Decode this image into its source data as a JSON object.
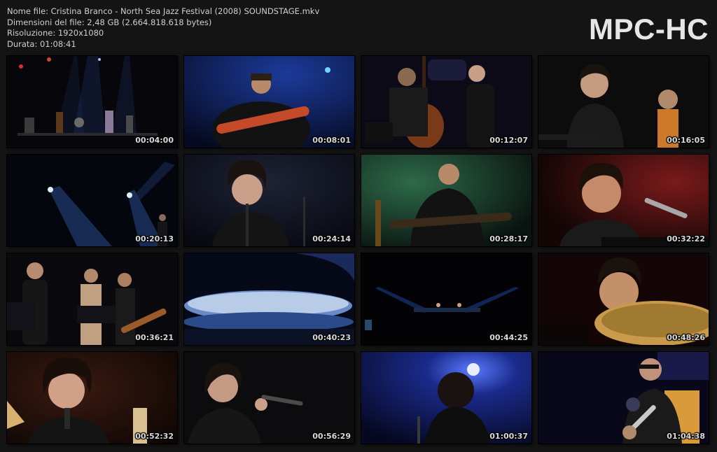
{
  "info": {
    "file_name": "Nome file: Cristina Branco - North Sea Jazz Festival (2008) SOUNDSTAGE.mkv",
    "file_size": "Dimensioni del file: 2,48 GB (2.664.818.618 bytes)",
    "resolution": "Risoluzione: 1920x1080",
    "duration": "Durata: 01:08:41"
  },
  "logo": "MPC-HC",
  "thumbnails": [
    {
      "time": "00:04:00",
      "scene": "wide-stage-band"
    },
    {
      "time": "00:08:01",
      "scene": "guitarist-blue"
    },
    {
      "time": "00:12:07",
      "scene": "bassist-and-singer"
    },
    {
      "time": "00:16:05",
      "scene": "singer-closeup-guitarist"
    },
    {
      "time": "00:20:13",
      "scene": "spotlights-singer"
    },
    {
      "time": "00:24:14",
      "scene": "singer-hand-to-head"
    },
    {
      "time": "00:28:17",
      "scene": "guitarist-green"
    },
    {
      "time": "00:32:22",
      "scene": "pianist-red"
    },
    {
      "time": "00:36:21",
      "scene": "band-onstage"
    },
    {
      "time": "00:40:23",
      "scene": "cymbal-closeup"
    },
    {
      "time": "00:44:25",
      "scene": "wide-stage-dark"
    },
    {
      "time": "00:48:26",
      "scene": "drummer-cymbal"
    },
    {
      "time": "00:52:32",
      "scene": "singer-microphone"
    },
    {
      "time": "00:56:29",
      "scene": "singer-eyes-closed"
    },
    {
      "time": "01:00:37",
      "scene": "singer-backlit"
    },
    {
      "time": "01:04:38",
      "scene": "trumpet-player"
    }
  ],
  "colors": {
    "background": "#141414",
    "text": "#cfcfcf",
    "logo": "#e6e6e6"
  }
}
